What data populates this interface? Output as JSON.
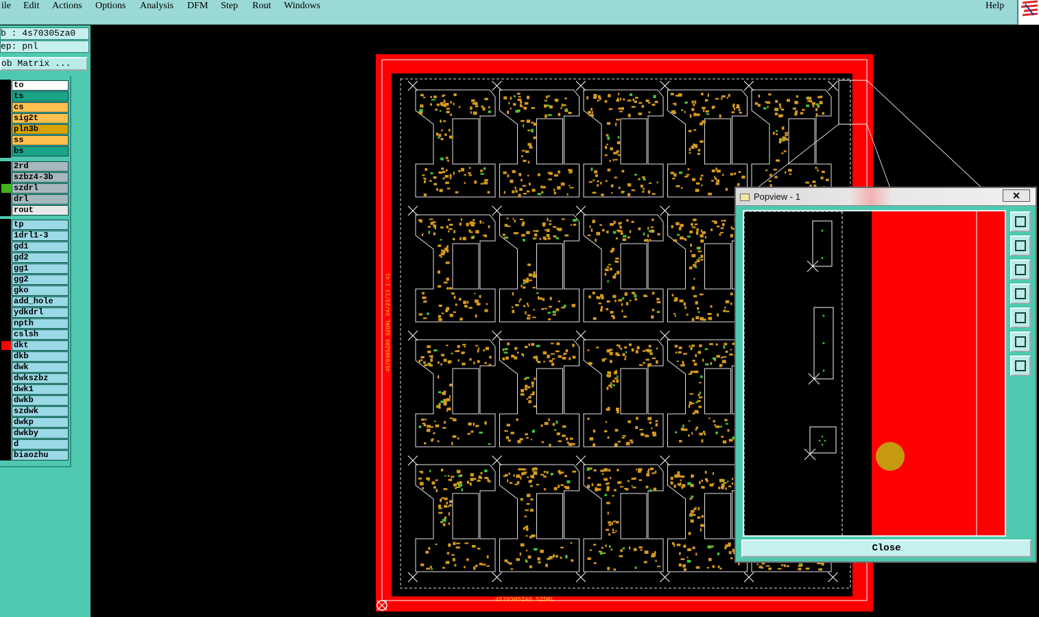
{
  "menubar": {
    "items": [
      "ile",
      "Edit",
      "Actions",
      "Options",
      "Analysis",
      "DFM",
      "Step",
      "Rout",
      "Windows"
    ],
    "help": "Help"
  },
  "left_panel": {
    "job_line": "b : 4s70305za0",
    "step_line": "ep: pnl",
    "matrix_button": "ob Matrix ..."
  },
  "layers": {
    "group1": [
      {
        "name": "to",
        "bg": "#ffffff"
      },
      {
        "name": "ts",
        "bg": "#1aa488"
      },
      {
        "name": "cs",
        "bg": "#ffc04d"
      },
      {
        "name": "sig2t",
        "bg": "#ffc04d"
      },
      {
        "name": "pln3b",
        "bg": "#d8a300"
      },
      {
        "name": "ss",
        "bg": "#ffc04d"
      },
      {
        "name": "bs",
        "bg": "#1aa488"
      }
    ],
    "group2": [
      {
        "name": "2rd",
        "bg": "#a6b8bd"
      },
      {
        "name": "szbz4-3b",
        "bg": "#a6b8bd"
      },
      {
        "name": "szdrl",
        "bg": "#a6b8bd",
        "mark": "#3fb21c"
      },
      {
        "name": "drl",
        "bg": "#a6b8bd"
      },
      {
        "name": "rout",
        "bg": "#e8e8e8"
      }
    ],
    "group3": [
      {
        "name": "tp",
        "bg": "#9ad9e6"
      },
      {
        "name": "1drl1-3",
        "bg": "#9ad9e6"
      },
      {
        "name": "gd1",
        "bg": "#9ad9e6"
      },
      {
        "name": "gd2",
        "bg": "#9ad9e6"
      },
      {
        "name": "gg1",
        "bg": "#9ad9e6"
      },
      {
        "name": "gg2",
        "bg": "#9ad9e6"
      },
      {
        "name": "gko",
        "bg": "#9ad9e6"
      },
      {
        "name": "add_hole",
        "bg": "#9ad9e6"
      },
      {
        "name": "ydkdrl",
        "bg": "#9ad9e6"
      },
      {
        "name": "npth",
        "bg": "#9ad9e6"
      },
      {
        "name": "cslsh",
        "bg": "#9ad9e6"
      },
      {
        "name": "dkt",
        "bg": "#9ad9e6",
        "mark": "#ff0000"
      },
      {
        "name": "dkb",
        "bg": "#9ad9e6"
      },
      {
        "name": "dwk",
        "bg": "#9ad9e6"
      },
      {
        "name": "dwkszbz",
        "bg": "#9ad9e6"
      },
      {
        "name": "dwk1",
        "bg": "#9ad9e6"
      },
      {
        "name": "dwkb",
        "bg": "#9ad9e6"
      },
      {
        "name": "szdwk",
        "bg": "#9ad9e6"
      },
      {
        "name": "dwkp",
        "bg": "#9ad9e6"
      },
      {
        "name": "dwkby",
        "bg": "#9ad9e6"
      },
      {
        "name": "d",
        "bg": "#9ad9e6"
      },
      {
        "name": "biaozhu",
        "bg": "#9ad9e6"
      }
    ]
  },
  "board": {
    "bottom_label": "4S70305ZA0 SZDRL",
    "side_label": "4S70305ZA0 SZDRL 04/23/13 1:41"
  },
  "popview": {
    "title": "Popview - 1",
    "close_label": "Close"
  },
  "colors": {
    "accent": "#4ec9b0",
    "copper": "#d69a1c",
    "frame": "#ff0000"
  }
}
